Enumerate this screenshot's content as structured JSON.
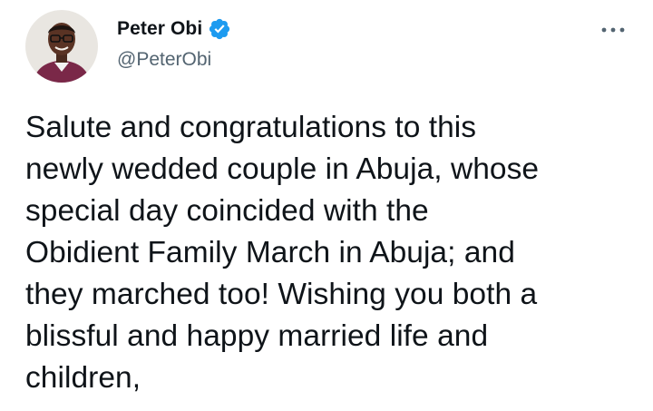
{
  "author": {
    "display_name": "Peter Obi",
    "handle": "@PeterObi",
    "verified": true,
    "verified_color": "#1d9bf0"
  },
  "tweet": {
    "text": "Salute and congratulations to this\nnewly wedded couple in Abuja, whose\nspecial day coincided with the\nObidient Family March in Abuja; and\nthey marched too! Wishing you both a\nblissful and happy married life and\nchildren,"
  },
  "icons": {
    "verified": "verified-badge-icon",
    "more": "more-dots-icon"
  },
  "colors": {
    "text_primary": "#0f1419",
    "text_secondary": "#536471",
    "accent": "#1d9bf0"
  }
}
